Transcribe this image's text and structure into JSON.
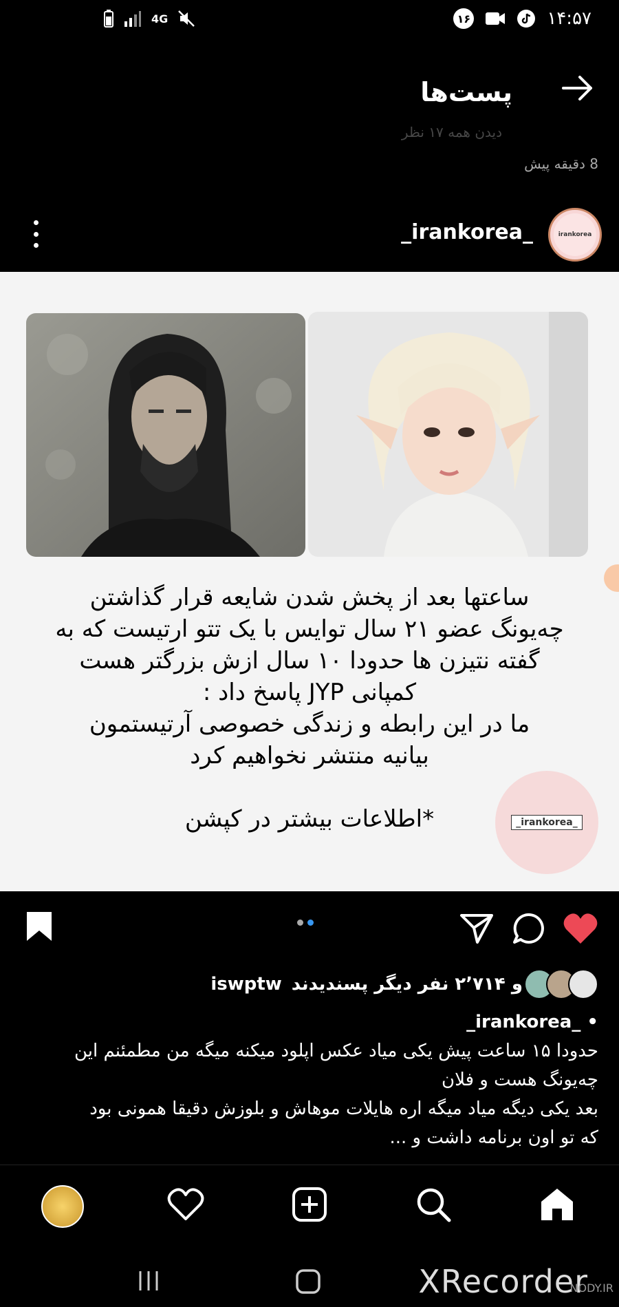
{
  "status_bar": {
    "network": "4G",
    "notification_count": "۱۶",
    "time": "۱۴:۵۷"
  },
  "header": {
    "title": "پست‌ها",
    "faded_text": "دیدن همه ۱۷ نظر",
    "time_ago": "8 دقیقه پیش"
  },
  "post": {
    "username": "_irankorea_",
    "avatar_text": "irankorea",
    "image_caption_lines": [
      "ساعتها بعد از پخش شدن شایعه قرار گذاشتن",
      "چه‌یونگ عضو ۲۱ سال توایس با یک تتو ارتیست که به",
      "گفته نتیزن ها حدودا ۱۰ سال ازش بزرگتر هست",
      "کمپانی JYP پاسخ داد :",
      "ما در این رابطه و زندگی خصوصی آرتیستمون",
      "بیانیه منتشر نخواهیم کرد",
      "",
      "*اطلاعات بیشتر در کپشن"
    ],
    "watermark": "_irankorea_"
  },
  "likes": {
    "liker": "iswptw",
    "text": "و ۲٬۷۱۴ نفر دیگر پسندیدند"
  },
  "caption": {
    "username": "_irankorea_",
    "lines": [
      "حدودا ۱۵ ساعت پیش یکی میاد عکس اپلود میکنه میگه من مطمئنم این",
      "چه‌یونگ هست و فلان",
      "بعد یکی دیگه میاد میگه اره هایلات موهاش و بلوزش دقیقا همونی بود",
      "که تو اون برنامه داشت و ..."
    ]
  },
  "recorder": {
    "brand": "XRecorder",
    "site": "NODY.IR"
  },
  "colors": {
    "like_red": "#ed4956",
    "dot_blue": "#3897f0",
    "background": "#000000",
    "post_bg": "#f4f4f4"
  }
}
